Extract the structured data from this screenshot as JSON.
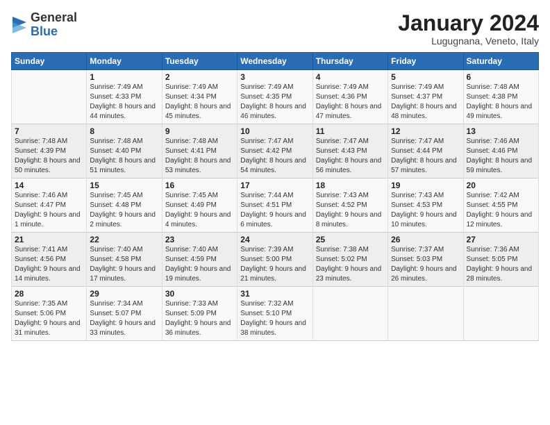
{
  "header": {
    "logo_general": "General",
    "logo_blue": "Blue",
    "month_title": "January 2024",
    "location": "Lugugnana, Veneto, Italy"
  },
  "days_of_week": [
    "Sunday",
    "Monday",
    "Tuesday",
    "Wednesday",
    "Thursday",
    "Friday",
    "Saturday"
  ],
  "weeks": [
    [
      {
        "day": "",
        "sunrise": "",
        "sunset": "",
        "daylight": ""
      },
      {
        "day": "1",
        "sunrise": "Sunrise: 7:49 AM",
        "sunset": "Sunset: 4:33 PM",
        "daylight": "Daylight: 8 hours and 44 minutes."
      },
      {
        "day": "2",
        "sunrise": "Sunrise: 7:49 AM",
        "sunset": "Sunset: 4:34 PM",
        "daylight": "Daylight: 8 hours and 45 minutes."
      },
      {
        "day": "3",
        "sunrise": "Sunrise: 7:49 AM",
        "sunset": "Sunset: 4:35 PM",
        "daylight": "Daylight: 8 hours and 46 minutes."
      },
      {
        "day": "4",
        "sunrise": "Sunrise: 7:49 AM",
        "sunset": "Sunset: 4:36 PM",
        "daylight": "Daylight: 8 hours and 47 minutes."
      },
      {
        "day": "5",
        "sunrise": "Sunrise: 7:49 AM",
        "sunset": "Sunset: 4:37 PM",
        "daylight": "Daylight: 8 hours and 48 minutes."
      },
      {
        "day": "6",
        "sunrise": "Sunrise: 7:48 AM",
        "sunset": "Sunset: 4:38 PM",
        "daylight": "Daylight: 8 hours and 49 minutes."
      }
    ],
    [
      {
        "day": "7",
        "sunrise": "Sunrise: 7:48 AM",
        "sunset": "Sunset: 4:39 PM",
        "daylight": "Daylight: 8 hours and 50 minutes."
      },
      {
        "day": "8",
        "sunrise": "Sunrise: 7:48 AM",
        "sunset": "Sunset: 4:40 PM",
        "daylight": "Daylight: 8 hours and 51 minutes."
      },
      {
        "day": "9",
        "sunrise": "Sunrise: 7:48 AM",
        "sunset": "Sunset: 4:41 PM",
        "daylight": "Daylight: 8 hours and 53 minutes."
      },
      {
        "day": "10",
        "sunrise": "Sunrise: 7:47 AM",
        "sunset": "Sunset: 4:42 PM",
        "daylight": "Daylight: 8 hours and 54 minutes."
      },
      {
        "day": "11",
        "sunrise": "Sunrise: 7:47 AM",
        "sunset": "Sunset: 4:43 PM",
        "daylight": "Daylight: 8 hours and 56 minutes."
      },
      {
        "day": "12",
        "sunrise": "Sunrise: 7:47 AM",
        "sunset": "Sunset: 4:44 PM",
        "daylight": "Daylight: 8 hours and 57 minutes."
      },
      {
        "day": "13",
        "sunrise": "Sunrise: 7:46 AM",
        "sunset": "Sunset: 4:46 PM",
        "daylight": "Daylight: 8 hours and 59 minutes."
      }
    ],
    [
      {
        "day": "14",
        "sunrise": "Sunrise: 7:46 AM",
        "sunset": "Sunset: 4:47 PM",
        "daylight": "Daylight: 9 hours and 1 minute."
      },
      {
        "day": "15",
        "sunrise": "Sunrise: 7:45 AM",
        "sunset": "Sunset: 4:48 PM",
        "daylight": "Daylight: 9 hours and 2 minutes."
      },
      {
        "day": "16",
        "sunrise": "Sunrise: 7:45 AM",
        "sunset": "Sunset: 4:49 PM",
        "daylight": "Daylight: 9 hours and 4 minutes."
      },
      {
        "day": "17",
        "sunrise": "Sunrise: 7:44 AM",
        "sunset": "Sunset: 4:51 PM",
        "daylight": "Daylight: 9 hours and 6 minutes."
      },
      {
        "day": "18",
        "sunrise": "Sunrise: 7:43 AM",
        "sunset": "Sunset: 4:52 PM",
        "daylight": "Daylight: 9 hours and 8 minutes."
      },
      {
        "day": "19",
        "sunrise": "Sunrise: 7:43 AM",
        "sunset": "Sunset: 4:53 PM",
        "daylight": "Daylight: 9 hours and 10 minutes."
      },
      {
        "day": "20",
        "sunrise": "Sunrise: 7:42 AM",
        "sunset": "Sunset: 4:55 PM",
        "daylight": "Daylight: 9 hours and 12 minutes."
      }
    ],
    [
      {
        "day": "21",
        "sunrise": "Sunrise: 7:41 AM",
        "sunset": "Sunset: 4:56 PM",
        "daylight": "Daylight: 9 hours and 14 minutes."
      },
      {
        "day": "22",
        "sunrise": "Sunrise: 7:40 AM",
        "sunset": "Sunset: 4:58 PM",
        "daylight": "Daylight: 9 hours and 17 minutes."
      },
      {
        "day": "23",
        "sunrise": "Sunrise: 7:40 AM",
        "sunset": "Sunset: 4:59 PM",
        "daylight": "Daylight: 9 hours and 19 minutes."
      },
      {
        "day": "24",
        "sunrise": "Sunrise: 7:39 AM",
        "sunset": "Sunset: 5:00 PM",
        "daylight": "Daylight: 9 hours and 21 minutes."
      },
      {
        "day": "25",
        "sunrise": "Sunrise: 7:38 AM",
        "sunset": "Sunset: 5:02 PM",
        "daylight": "Daylight: 9 hours and 23 minutes."
      },
      {
        "day": "26",
        "sunrise": "Sunrise: 7:37 AM",
        "sunset": "Sunset: 5:03 PM",
        "daylight": "Daylight: 9 hours and 26 minutes."
      },
      {
        "day": "27",
        "sunrise": "Sunrise: 7:36 AM",
        "sunset": "Sunset: 5:05 PM",
        "daylight": "Daylight: 9 hours and 28 minutes."
      }
    ],
    [
      {
        "day": "28",
        "sunrise": "Sunrise: 7:35 AM",
        "sunset": "Sunset: 5:06 PM",
        "daylight": "Daylight: 9 hours and 31 minutes."
      },
      {
        "day": "29",
        "sunrise": "Sunrise: 7:34 AM",
        "sunset": "Sunset: 5:07 PM",
        "daylight": "Daylight: 9 hours and 33 minutes."
      },
      {
        "day": "30",
        "sunrise": "Sunrise: 7:33 AM",
        "sunset": "Sunset: 5:09 PM",
        "daylight": "Daylight: 9 hours and 36 minutes."
      },
      {
        "day": "31",
        "sunrise": "Sunrise: 7:32 AM",
        "sunset": "Sunset: 5:10 PM",
        "daylight": "Daylight: 9 hours and 38 minutes."
      },
      {
        "day": "",
        "sunrise": "",
        "sunset": "",
        "daylight": ""
      },
      {
        "day": "",
        "sunrise": "",
        "sunset": "",
        "daylight": ""
      },
      {
        "day": "",
        "sunrise": "",
        "sunset": "",
        "daylight": ""
      }
    ]
  ]
}
